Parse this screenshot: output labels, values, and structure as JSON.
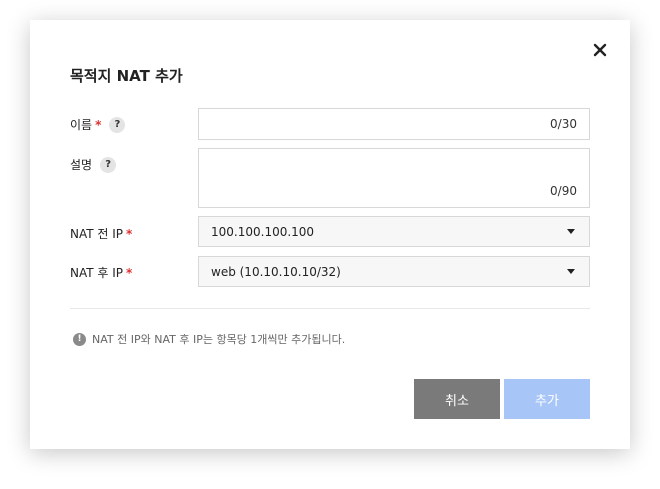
{
  "dialog": {
    "title": "목적지 NAT 추가",
    "close_icon": "close-icon"
  },
  "form": {
    "name": {
      "label": "이름",
      "required_mark": "*",
      "help_glyph": "?",
      "value": "",
      "counter": "0/30"
    },
    "description": {
      "label": "설명",
      "help_glyph": "?",
      "value": "",
      "counter": "0/90"
    },
    "pre_nat_ip": {
      "label": "NAT 전 IP",
      "required_mark": "*",
      "selected": "100.100.100.100"
    },
    "post_nat_ip": {
      "label": "NAT 후 IP",
      "required_mark": "*",
      "selected": "web (10.10.10.10/32)"
    }
  },
  "notice": {
    "icon_glyph": "!",
    "text": "NAT 전 IP와 NAT 후 IP는 항목당 1개씩만 추가됩니다."
  },
  "buttons": {
    "cancel_label": "취소",
    "add_label": "추가"
  },
  "colors": {
    "required": "#e03131",
    "cancel_button": "#7a7a7a",
    "add_button_disabled": "#a7c6f7"
  }
}
